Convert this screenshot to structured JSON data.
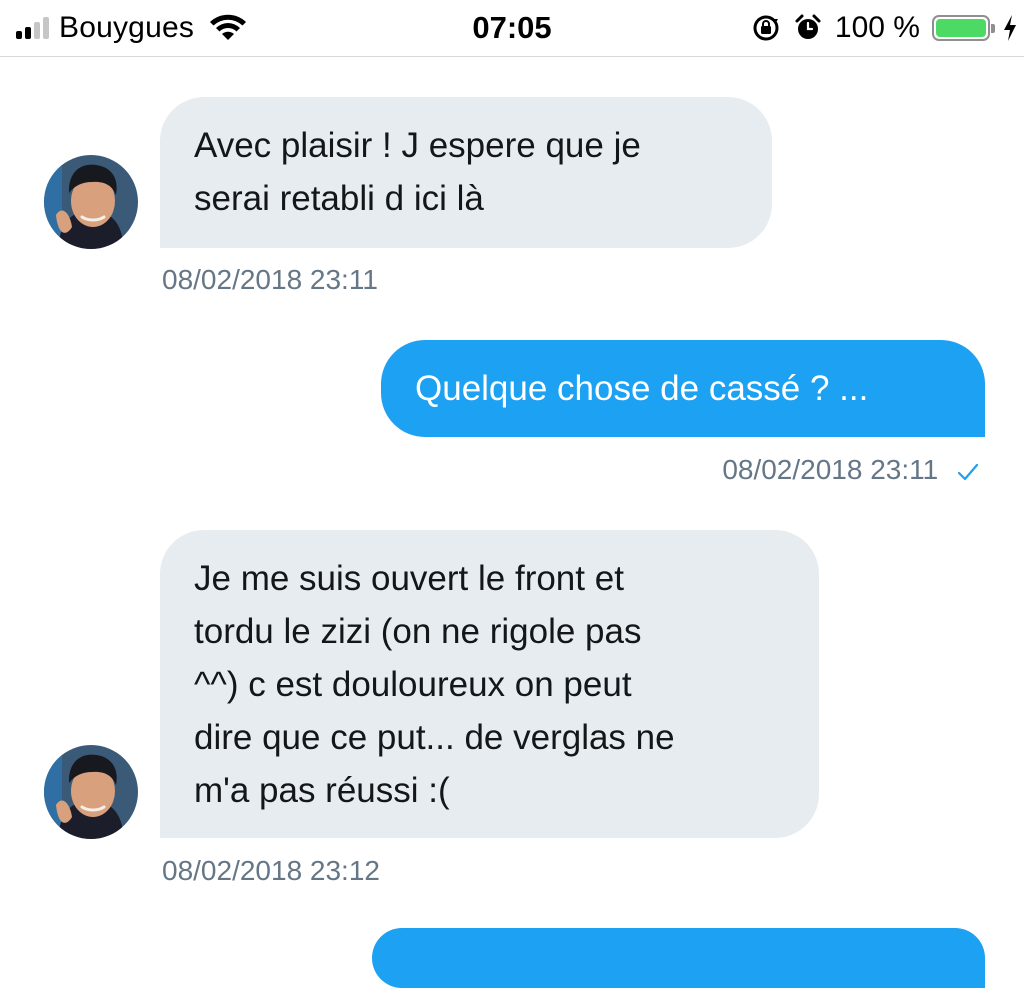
{
  "status_bar": {
    "carrier": "Bouygues",
    "time": "07:05",
    "battery_percent": "100 %",
    "battery_level": 1.0,
    "signal_bars_filled": 2,
    "signal_bars_total": 4,
    "icons": [
      "signal-icon",
      "wifi-icon",
      "rotation-lock-icon",
      "alarm-icon",
      "battery-icon",
      "charging-bolt-icon"
    ]
  },
  "colors": {
    "incoming_bubble": "#e6ecf0",
    "outgoing_bubble": "#1da1f2",
    "timestamp": "#657786",
    "read_check": "#1da1f2"
  },
  "messages": [
    {
      "direction": "incoming",
      "lines": [
        "Avec plaisir ! J espere que je",
        "serai retabli d ici là"
      ],
      "timestamp": "08/02/2018 23:11"
    },
    {
      "direction": "outgoing",
      "lines": [
        "Quelque chose de cassé ? ..."
      ],
      "timestamp": "08/02/2018 23:11",
      "status_icon": "check-icon"
    },
    {
      "direction": "incoming",
      "lines": [
        "Je me suis ouvert le front et",
        "tordu le zizi (on ne rigole pas",
        "^^) c est douloureux on peut",
        "dire que ce put... de verglas ne",
        "m'a pas réussi :("
      ],
      "timestamp": "08/02/2018 23:12"
    }
  ]
}
